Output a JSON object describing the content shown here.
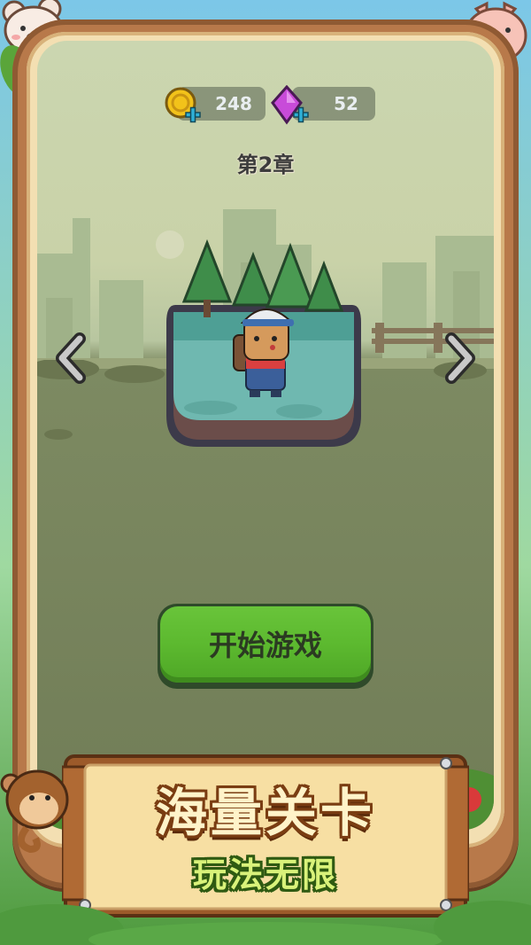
{
  "hud": {
    "coins": "248",
    "gems": "52",
    "coin_icon": "gold-coin-plus-icon",
    "gem_icon": "purple-gem-plus-icon"
  },
  "level": {
    "chapter": "第2章",
    "prev_icon": "chevron-left-icon",
    "next_icon": "chevron-right-icon"
  },
  "start_button": {
    "label": "开始游戏",
    "color": "#5cb92f"
  },
  "banner": {
    "title": "海量关卡",
    "subtitle": "玩法无限"
  },
  "colors": {
    "frame_wood": "#b8794a",
    "screen_bg": "#717d57",
    "card_water": "#6fb8b0",
    "banner_paper": "#f7dfa3"
  }
}
